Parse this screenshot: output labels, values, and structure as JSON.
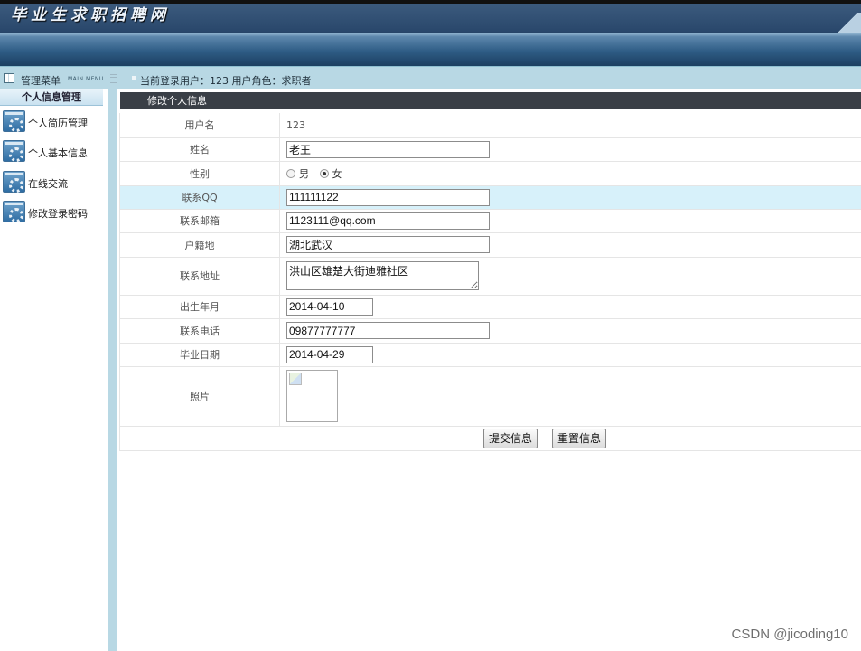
{
  "header": {
    "logo_text": "毕业生求职招聘网"
  },
  "status_bar": {
    "menu_label": "管理菜单",
    "menu_label_en": "MAIN MENU",
    "user_info": "当前登录用户：123  用户角色：求职者"
  },
  "sidebar": {
    "section_title": "个人信息管理",
    "items": [
      {
        "label": "个人简历管理",
        "icon": "settings-gear-icon"
      },
      {
        "label": "个人基本信息",
        "icon": "settings-gear-icon"
      },
      {
        "label": "在线交流",
        "icon": "settings-gear-icon"
      },
      {
        "label": "修改登录密码",
        "icon": "settings-gear-icon"
      }
    ]
  },
  "panel": {
    "title": "修改个人信息"
  },
  "form": {
    "username": {
      "label": "用户名",
      "value": "123"
    },
    "name": {
      "label": "姓名",
      "value": "老王"
    },
    "gender": {
      "label": "性别",
      "option_male": "男",
      "option_female": "女",
      "selected": "女"
    },
    "qq": {
      "label": "联系QQ",
      "value": "111111122"
    },
    "email": {
      "label": "联系邮箱",
      "value": "1123111@qq.com"
    },
    "hometown": {
      "label": "户籍地",
      "value": "湖北武汉"
    },
    "address": {
      "label": "联系地址",
      "value": "洪山区雄楚大街迪雅社区"
    },
    "birth": {
      "label": "出生年月",
      "value": "2014-04-10"
    },
    "phone": {
      "label": "联系电话",
      "value": "09877777777"
    },
    "graduation": {
      "label": "毕业日期",
      "value": "2014-04-29"
    },
    "photo": {
      "label": "照片",
      "icon": "broken-image-icon"
    },
    "submit_label": "提交信息",
    "reset_label": "重置信息"
  },
  "watermark": "CSDN @jicoding10",
  "colors": {
    "header_dark": "#1d3a5b",
    "status_bar": "#b8d8e4",
    "panel_title_bg": "#3a3f46",
    "highlight_row": "#d7f1fa"
  }
}
